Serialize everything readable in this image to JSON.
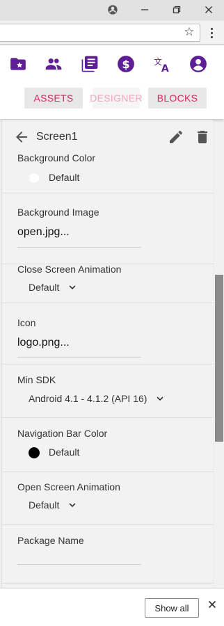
{
  "browser": {
    "icons": {
      "account": "account-circle-icon",
      "minimize": "minimize-icon",
      "restore": "restore-icon",
      "close": "close-icon",
      "bookmark": "star-icon",
      "menu": "more-vert-icon"
    }
  },
  "appbar": {
    "icons": [
      "folder-star-icon",
      "people-icon",
      "library-books-icon",
      "dollar-icon",
      "translate-icon",
      "account-icon"
    ],
    "accent_color": "#5e1e96",
    "tabs": {
      "assets": "ASSETS",
      "designer": "DESIGNER",
      "blocks": "BLOCKS"
    },
    "tab_color": "#e91e63"
  },
  "panel": {
    "screen_name": "Screen1",
    "properties": {
      "background_color": {
        "label": "Background Color",
        "value": "Default"
      },
      "background_image": {
        "label": "Background Image",
        "value": "open.jpg..."
      },
      "close_screen_animation": {
        "label": "Close Screen Animation",
        "value": "Default"
      },
      "icon": {
        "label": "Icon",
        "value": "logo.png..."
      },
      "min_sdk": {
        "label": "Min SDK",
        "value": "Android 4.1 - 4.1.2 (API 16)"
      },
      "navigation_bar_color": {
        "label": "Navigation Bar Color",
        "value": "Default"
      },
      "open_screen_animation": {
        "label": "Open Screen Animation",
        "value": "Default"
      },
      "package_name": {
        "label": "Package Name",
        "value": ""
      }
    }
  },
  "download_bar": {
    "show_all": "Show all"
  }
}
